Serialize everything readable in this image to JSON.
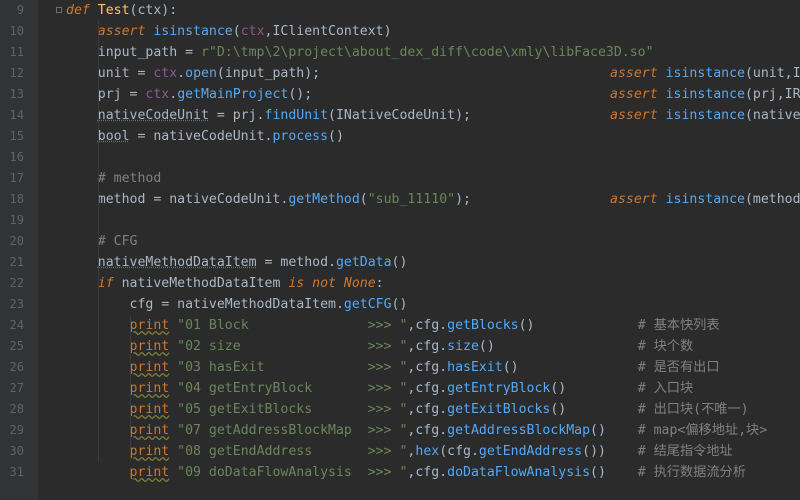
{
  "editor": {
    "language": "Python",
    "theme": {
      "background": "#2b2b2b",
      "gutter": "#313335",
      "keyword": "#cc7832",
      "function": "#ffc66d",
      "string": "#6a8759",
      "comment": "#808080",
      "call": "#56a8f5"
    }
  },
  "lines": [
    {
      "num": "9",
      "tokens": [
        [
          "kwi",
          "def "
        ],
        [
          "fn",
          "Test"
        ],
        [
          "p",
          "(ctx):"
        ]
      ]
    },
    {
      "num": "10",
      "tokens": [
        [
          "p",
          "    "
        ],
        [
          "kwi",
          "assert "
        ],
        [
          "call",
          "isinstance"
        ],
        [
          "p",
          "("
        ],
        [
          "self",
          "ctx"
        ],
        [
          "p",
          ",IClientContext)"
        ]
      ]
    },
    {
      "num": "11",
      "tokens": [
        [
          "p",
          "    input_path = "
        ],
        [
          "str",
          "r\"D:\\tmp\\2\\project\\about_dex_diff\\code\\xmly\\libFace3D.so\""
        ]
      ]
    },
    {
      "num": "12",
      "tokens": [
        [
          "p",
          "    unit = "
        ],
        [
          "self",
          "ctx"
        ],
        [
          "p",
          "."
        ],
        [
          "call",
          "open"
        ],
        [
          "p",
          "(input_path);"
        ]
      ],
      "right": [
        [
          "kwi",
          "assert "
        ],
        [
          "call",
          "isinstance"
        ],
        [
          "p",
          "(unit,I"
        ]
      ]
    },
    {
      "num": "13",
      "tokens": [
        [
          "p",
          "    prj = "
        ],
        [
          "self",
          "ctx"
        ],
        [
          "p",
          "."
        ],
        [
          "call",
          "getMainProject"
        ],
        [
          "p",
          "();"
        ]
      ],
      "right": [
        [
          "kwi",
          "assert "
        ],
        [
          "call",
          "isinstance"
        ],
        [
          "p",
          "(prj,IR"
        ]
      ]
    },
    {
      "num": "14",
      "tokens": [
        [
          "p",
          "    "
        ],
        [
          "dot",
          "nativeCodeUnit"
        ],
        [
          "p",
          " = prj."
        ],
        [
          "call",
          "findUnit"
        ],
        [
          "p",
          "(INativeCodeUnit);"
        ]
      ],
      "right": [
        [
          "kwi",
          "assert "
        ],
        [
          "call",
          "isinstance"
        ],
        [
          "p",
          "(native"
        ]
      ]
    },
    {
      "num": "15",
      "tokens": [
        [
          "p",
          "    "
        ],
        [
          "dotm",
          "bool"
        ],
        [
          "p",
          " = nativeCodeUnit."
        ],
        [
          "call",
          "process"
        ],
        [
          "p",
          "()"
        ]
      ]
    },
    {
      "num": "16",
      "tokens": []
    },
    {
      "num": "17",
      "tokens": [
        [
          "p",
          "    "
        ],
        [
          "com",
          "# method"
        ]
      ]
    },
    {
      "num": "18",
      "tokens": [
        [
          "p",
          "    method = nativeCodeUnit."
        ],
        [
          "call",
          "getMethod"
        ],
        [
          "p",
          "("
        ],
        [
          "str",
          "\"sub_11110\""
        ],
        [
          "p",
          ");"
        ]
      ],
      "right": [
        [
          "kwi",
          "assert "
        ],
        [
          "call",
          "isinstance"
        ],
        [
          "p",
          "(method"
        ]
      ]
    },
    {
      "num": "19",
      "tokens": []
    },
    {
      "num": "20",
      "tokens": [
        [
          "p",
          "    "
        ],
        [
          "com",
          "# CFG"
        ]
      ]
    },
    {
      "num": "21",
      "tokens": [
        [
          "p",
          "    "
        ],
        [
          "dot",
          "nativeMethodDataItem"
        ],
        [
          "p",
          " = method."
        ],
        [
          "call",
          "getData"
        ],
        [
          "p",
          "()"
        ]
      ]
    },
    {
      "num": "22",
      "tokens": [
        [
          "p",
          "    "
        ],
        [
          "kwi",
          "if "
        ],
        [
          "p",
          "nativeMethodDataItem "
        ],
        [
          "kwi",
          "is not None"
        ],
        [
          "p",
          ":"
        ]
      ]
    },
    {
      "num": "23",
      "tokens": [
        [
          "p",
          "        cfg = nativeMethodDataItem."
        ],
        [
          "call",
          "getCFG"
        ],
        [
          "p",
          "()"
        ]
      ]
    },
    {
      "num": "24",
      "tokens": [
        [
          "p",
          "        "
        ],
        [
          "wav",
          "print"
        ],
        [
          "str",
          " \"01 Block               >>> \""
        ],
        [
          "p",
          ",cfg."
        ],
        [
          "call",
          "getBlocks"
        ],
        [
          "p",
          "()             "
        ],
        [
          "com",
          "# 基本快列表"
        ]
      ]
    },
    {
      "num": "25",
      "tokens": [
        [
          "p",
          "        "
        ],
        [
          "wav",
          "print"
        ],
        [
          "str",
          " \"02 size                >>> \""
        ],
        [
          "p",
          ",cfg."
        ],
        [
          "call",
          "size"
        ],
        [
          "p",
          "()                  "
        ],
        [
          "com",
          "# 块个数"
        ]
      ]
    },
    {
      "num": "26",
      "tokens": [
        [
          "p",
          "        "
        ],
        [
          "wav",
          "print"
        ],
        [
          "str",
          " \"03 hasExit             >>> \""
        ],
        [
          "p",
          ",cfg."
        ],
        [
          "call",
          "hasExit"
        ],
        [
          "p",
          "()               "
        ],
        [
          "com",
          "# 是否有出口"
        ]
      ]
    },
    {
      "num": "27",
      "tokens": [
        [
          "p",
          "        "
        ],
        [
          "wav",
          "print"
        ],
        [
          "str",
          " \"04 getEntryBlock       >>> \""
        ],
        [
          "p",
          ",cfg."
        ],
        [
          "call",
          "getEntryBlock"
        ],
        [
          "p",
          "()         "
        ],
        [
          "com",
          "# 入口块"
        ]
      ]
    },
    {
      "num": "28",
      "tokens": [
        [
          "p",
          "        "
        ],
        [
          "wav",
          "print"
        ],
        [
          "str",
          " \"05 getExitBlocks       >>> \""
        ],
        [
          "p",
          ",cfg."
        ],
        [
          "call",
          "getExitBlocks"
        ],
        [
          "p",
          "()         "
        ],
        [
          "com",
          "# 出口块(不唯一)"
        ]
      ]
    },
    {
      "num": "29",
      "tokens": [
        [
          "p",
          "        "
        ],
        [
          "wav",
          "print"
        ],
        [
          "str",
          " \"07 getAddressBlockMap  >>> \""
        ],
        [
          "p",
          ",cfg."
        ],
        [
          "call",
          "getAddressBlockMap"
        ],
        [
          "p",
          "()    "
        ],
        [
          "com",
          "# map<偏移地址,块>"
        ]
      ]
    },
    {
      "num": "30",
      "tokens": [
        [
          "p",
          "        "
        ],
        [
          "wav",
          "print"
        ],
        [
          "str",
          " \"08 getEndAddress       >>> \""
        ],
        [
          "p",
          ","
        ],
        [
          "call",
          "hex"
        ],
        [
          "p",
          "(cfg."
        ],
        [
          "call",
          "getEndAddress"
        ],
        [
          "p",
          "())    "
        ],
        [
          "com",
          "# 结尾指令地址"
        ]
      ]
    },
    {
      "num": "31",
      "tokens": [
        [
          "p",
          "        "
        ],
        [
          "wav",
          "print"
        ],
        [
          "str",
          " \"09 doDataFlowAnalysis  >>> \""
        ],
        [
          "p",
          ",cfg."
        ],
        [
          "call",
          "doDataFlowAnalysis"
        ],
        [
          "p",
          "()    "
        ],
        [
          "com",
          "# 执行数据流分析"
        ]
      ]
    }
  ]
}
